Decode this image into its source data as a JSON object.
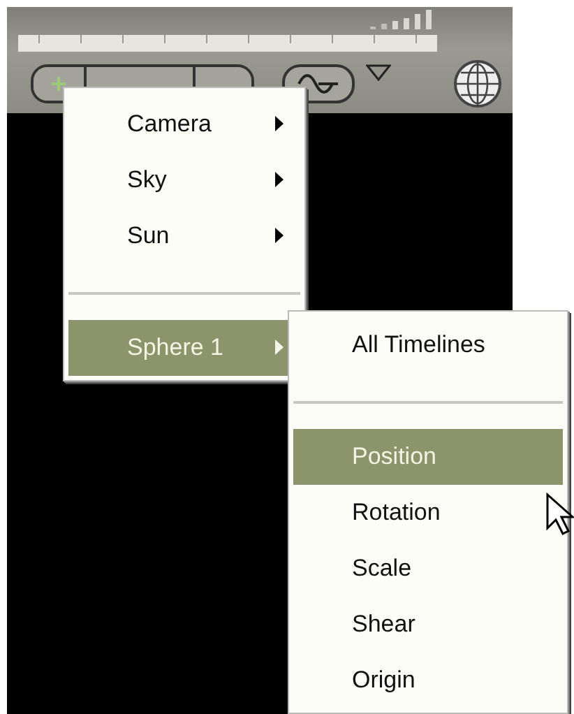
{
  "menus": [
    {
      "items": [
        {
          "kind": "item",
          "label": "Camera",
          "submenu": true,
          "selected": false
        },
        {
          "kind": "item",
          "label": "Sky",
          "submenu": true,
          "selected": false
        },
        {
          "kind": "item",
          "label": "Sun",
          "submenu": true,
          "selected": false
        },
        {
          "kind": "separator"
        },
        {
          "kind": "item",
          "label": "Sphere 1",
          "submenu": true,
          "selected": true
        }
      ]
    },
    {
      "items": [
        {
          "kind": "item",
          "label": "All Timelines",
          "submenu": false,
          "selected": false
        },
        {
          "kind": "separator"
        },
        {
          "kind": "item",
          "label": "Position",
          "submenu": false,
          "selected": true
        },
        {
          "kind": "item",
          "label": "Rotation",
          "submenu": false,
          "selected": false
        },
        {
          "kind": "item",
          "label": "Scale",
          "submenu": false,
          "selected": false
        },
        {
          "kind": "item",
          "label": "Shear",
          "submenu": false,
          "selected": false
        },
        {
          "kind": "item",
          "label": "Origin",
          "submenu": false,
          "selected": false
        }
      ]
    }
  ]
}
